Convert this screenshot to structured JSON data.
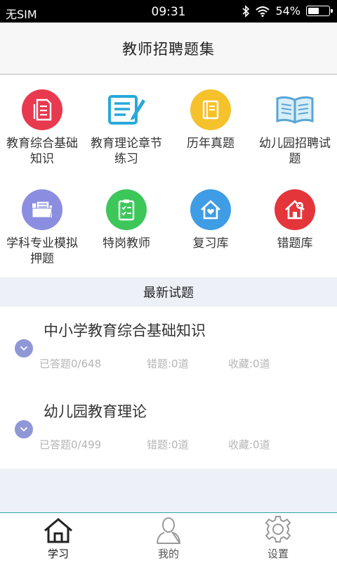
{
  "status": {
    "carrier": "无SIM",
    "time": "09:31",
    "battery": "54%",
    "battery_level": 0.54
  },
  "header": {
    "title": "教师招聘题集"
  },
  "categories": [
    {
      "label": "教育综合基础知识",
      "icon": "document-icon",
      "color": "#e8394f"
    },
    {
      "label": "教育理论章节练习",
      "icon": "edit-list-icon",
      "color": "#27a9d9"
    },
    {
      "label": "历年真题",
      "icon": "book-icon",
      "color": "#f5c22c"
    },
    {
      "label": "幼儿园招聘试题",
      "icon": "open-book-icon",
      "color": "#5aa5d6"
    },
    {
      "label": "学科专业模拟押题",
      "icon": "folder-icon",
      "color": "#8b8ee0"
    },
    {
      "label": "特岗教师",
      "icon": "clipboard-icon",
      "color": "#3dc65a"
    },
    {
      "label": "复习库",
      "icon": "home-heart-icon",
      "color": "#3f9de5"
    },
    {
      "label": "错题库",
      "icon": "home-x-icon",
      "color": "#e4353a"
    }
  ],
  "section": {
    "title": "最新试题"
  },
  "exams": [
    {
      "name": "中小学教育综合基础知识",
      "answered": "已答题0/648",
      "wrong": "错题:0道",
      "saved": "收藏:0道"
    },
    {
      "name": "幼儿园教育理论",
      "answered": "已答题0/499",
      "wrong": "错题:0道",
      "saved": "收藏:0道"
    }
  ],
  "tabs": [
    {
      "label": "学习",
      "icon": "home-icon",
      "active": true
    },
    {
      "label": "我的",
      "icon": "user-icon",
      "active": false
    },
    {
      "label": "设置",
      "icon": "gear-icon",
      "active": false
    }
  ]
}
